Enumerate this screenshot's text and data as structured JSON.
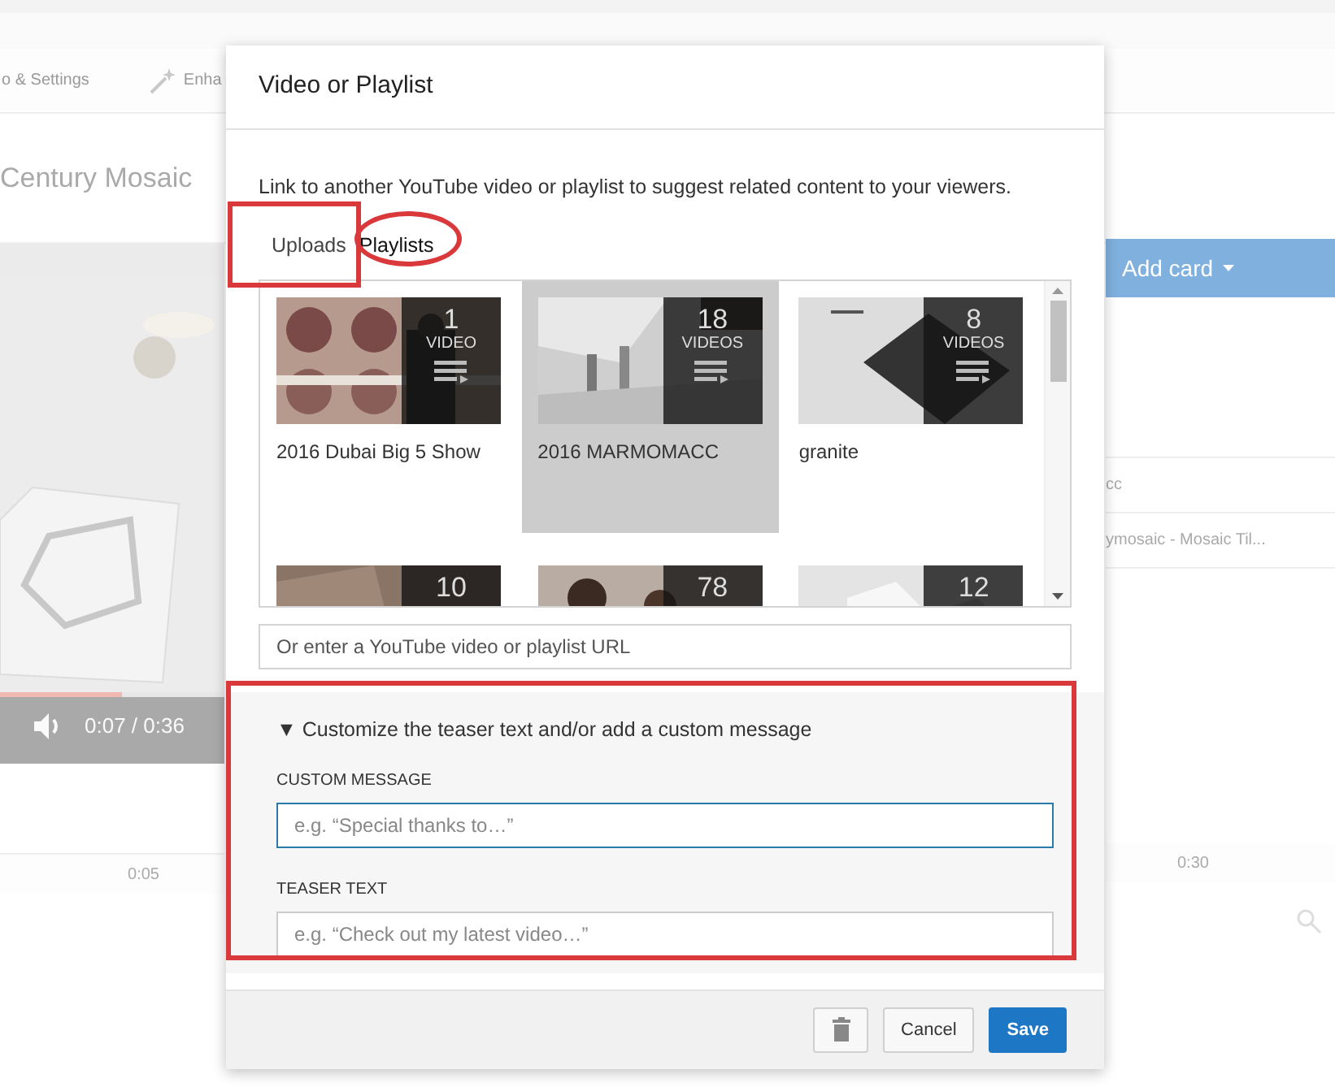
{
  "background": {
    "toolbar": [
      {
        "label": "o & Settings",
        "kind": "text"
      },
      {
        "label": "Enha",
        "kind": "wand"
      }
    ],
    "video_title": "Century Mosaic",
    "player": {
      "time": "0:07 / 0:36",
      "level": 0.54
    },
    "add_card": "Add card",
    "rows": [
      "cc",
      "ymosaic - Mosaic Til..."
    ],
    "timeline": [
      "0:05",
      "0:30"
    ]
  },
  "dialog": {
    "title": "Video or Playlist",
    "description": "Link to another YouTube video or playlist to suggest related content to your viewers.",
    "tabs": [
      {
        "label": "Uploads",
        "selected": false
      },
      {
        "label": "Playlists",
        "selected": true
      }
    ],
    "playlists": [
      {
        "name": "2016 Dubai Big 5 Show",
        "count": "1",
        "unit": "VIDEO",
        "selected": false
      },
      {
        "name": "2016 MARMOMACC",
        "count": "18",
        "unit": "VIDEOS",
        "selected": true
      },
      {
        "name": "granite",
        "count": "8",
        "unit": "VIDEOS",
        "selected": false
      },
      {
        "count": "10",
        "selected": false
      },
      {
        "count": "78",
        "selected": false
      },
      {
        "count": "12",
        "selected": false
      }
    ],
    "url_field": {
      "placeholder": "Or enter a YouTube video or playlist URL"
    },
    "customize": {
      "heading": "▼ Customize the teaser text and/or add a custom message",
      "expanded": true,
      "custom_message": {
        "label": "CUSTOM MESSAGE",
        "placeholder": "e.g. “Special thanks to…”"
      },
      "teaser_text": {
        "label": "TEASER TEXT",
        "placeholder": "e.g. “Check out my latest video…”"
      }
    },
    "buttons": {
      "cancel": "Cancel",
      "save": "Save"
    }
  }
}
